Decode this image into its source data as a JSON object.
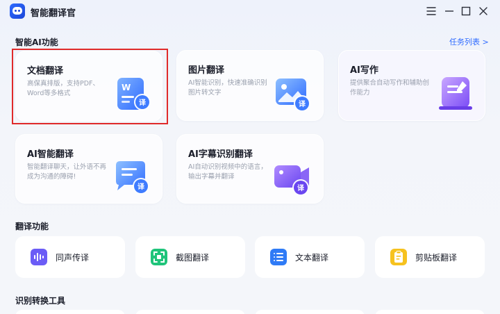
{
  "app": {
    "title": "智能翻译官",
    "logo_icon": "chat-bubble-logo-icon"
  },
  "window_controls": [
    "menu-icon",
    "minimize-icon",
    "maximize-icon",
    "close-icon"
  ],
  "ai_section": {
    "title": "智能AI功能",
    "task_list_link": "任务列表 >"
  },
  "cards": [
    {
      "title": "文档翻译",
      "desc": "高保真排版，支持PDF、Word等多格式",
      "icon": "word-document-icon",
      "badge": "译",
      "selected": true
    },
    {
      "title": "图片翻译",
      "desc": "AI智能识别，快速准确识别图片转文字",
      "icon": "image-icon",
      "badge": "译"
    },
    {
      "title": "AI写作",
      "desc": "提供聚合自动写作和辅助创作能力",
      "icon": "writing-pad-icon"
    },
    {
      "title": "AI智能翻译",
      "desc": "智能翻译聊天，让外语不再成为沟通的障碍!",
      "icon": "chat-message-icon",
      "badge": "译"
    },
    {
      "title": "AI字幕识别翻译",
      "desc": "AI自动识别视频中的语言，输出字幕并翻译",
      "icon": "video-camera-icon",
      "badge": "译"
    }
  ],
  "translate_section": {
    "title": "翻译功能"
  },
  "tools": [
    {
      "label": "同声传译",
      "icon": "audio-wave-icon",
      "color": "#6b5cf6"
    },
    {
      "label": "截图翻译",
      "icon": "screenshot-icon",
      "color": "#1fc47a"
    },
    {
      "label": "文本翻译",
      "icon": "text-list-icon",
      "color": "#2f7bf6"
    },
    {
      "label": "剪贴板翻译",
      "icon": "clipboard-icon",
      "color": "#f6c21f"
    }
  ],
  "convert_section": {
    "title": "识别转换工具"
  },
  "colors": {
    "accent": "#2f6bff",
    "highlight": "#e02a2a"
  }
}
